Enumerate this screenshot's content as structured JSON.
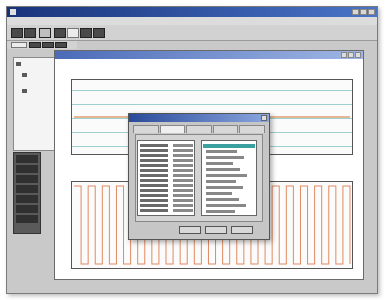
{
  "window": {
    "title": "",
    "menus": [
      "",
      "",
      "",
      "",
      "",
      ""
    ]
  },
  "chart_window": {
    "title": ""
  },
  "tree": {
    "nodes": [
      "",
      "",
      ""
    ]
  },
  "left_list": {
    "rows": [
      "",
      "",
      "",
      "",
      "",
      "",
      ""
    ]
  },
  "dialog": {
    "title": "",
    "tabs": [
      "",
      "",
      "",
      "",
      ""
    ],
    "buttons": [
      "",
      "",
      ""
    ]
  },
  "chart_data": [
    {
      "type": "line",
      "title": "",
      "xlabel": "",
      "ylabel": "",
      "series": [
        {
          "values": [
            0.5,
            0.5,
            0.5,
            0.5,
            0.5,
            0.5,
            0.5,
            0.5,
            0.5,
            0.5,
            0.5,
            0.5
          ]
        }
      ],
      "ylim": [
        0,
        1
      ],
      "grid": true
    },
    {
      "type": "line",
      "title": "",
      "xlabel": "",
      "ylabel": "",
      "series": [
        {
          "values": [
            1,
            0,
            1,
            0,
            1,
            0,
            1,
            0,
            1,
            0,
            1,
            0,
            1,
            0,
            1,
            0,
            1,
            0,
            1,
            0,
            1,
            0,
            1,
            0,
            1,
            0,
            1,
            0,
            1,
            0,
            1,
            0,
            1,
            0,
            1,
            0,
            1,
            0,
            1,
            0
          ]
        }
      ],
      "ylim": [
        0,
        1
      ],
      "grid": false
    }
  ],
  "colors": {
    "titlebar": "#18337a",
    "grid": "#9fd0cf",
    "trace1": "#e0a070",
    "trace2": "#e08a60",
    "selection": "#3aa0a0"
  }
}
